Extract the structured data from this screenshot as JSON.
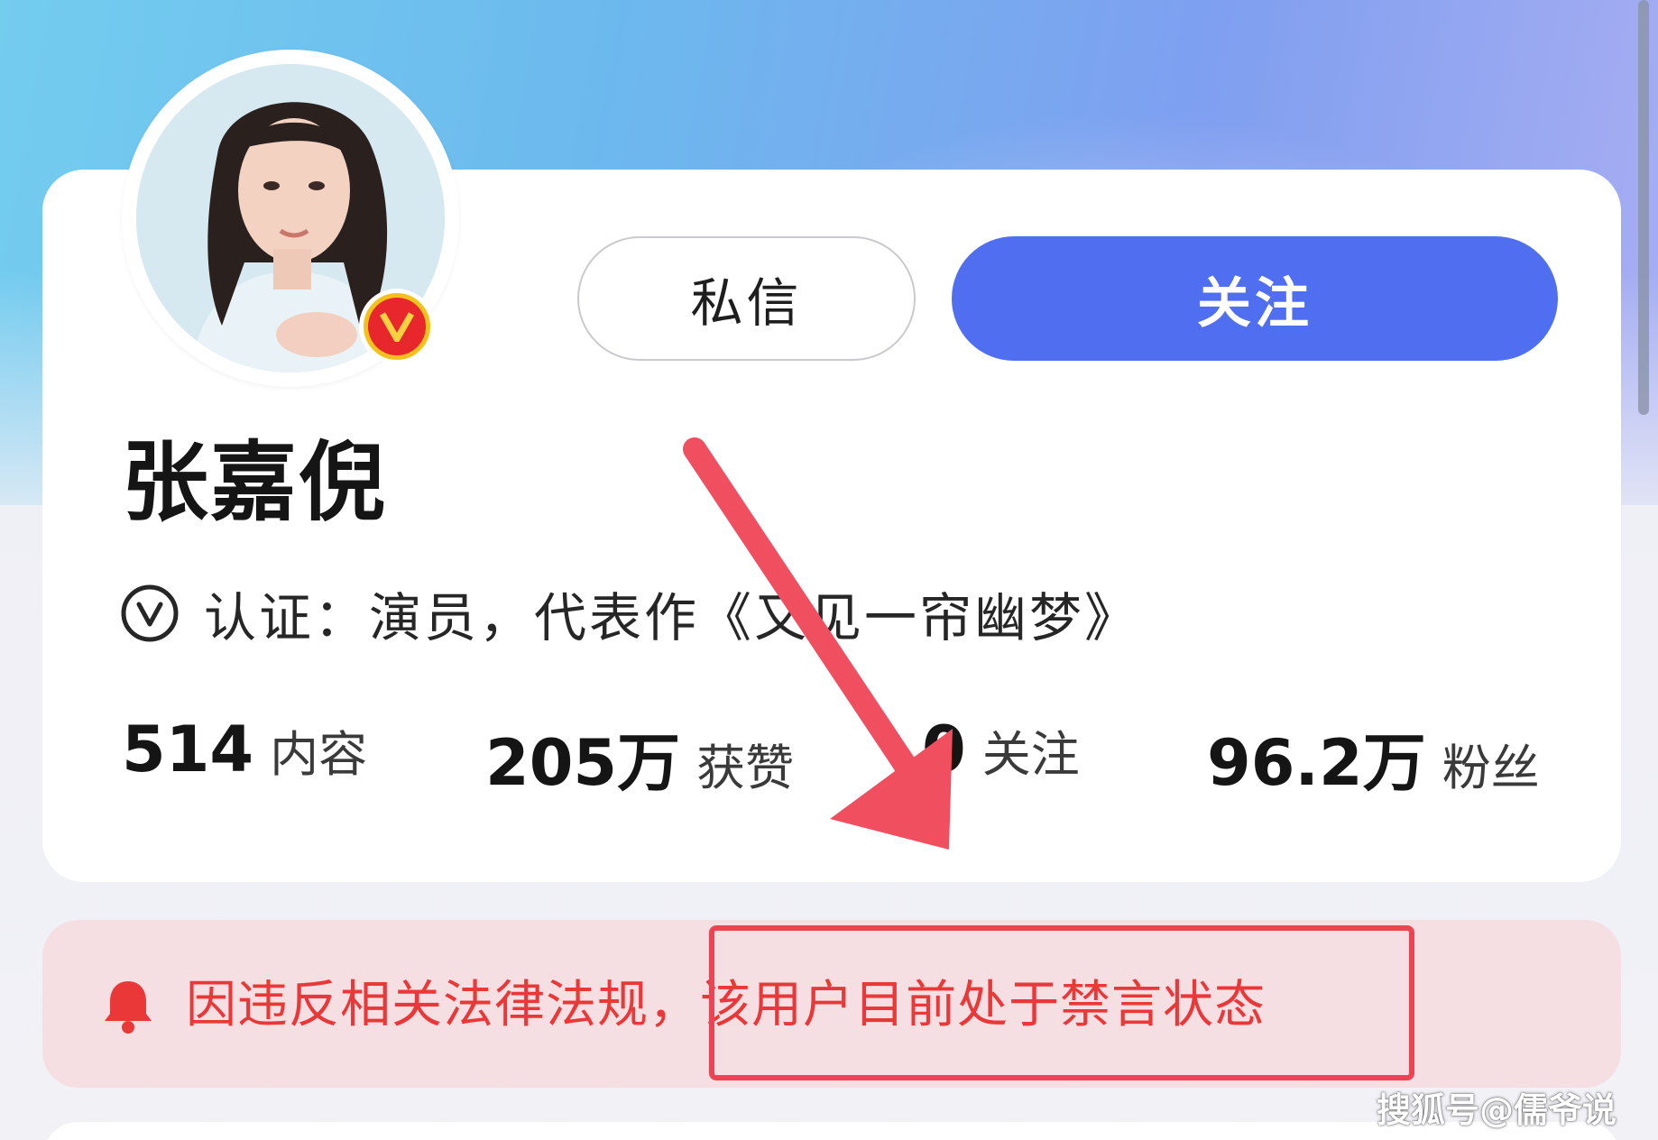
{
  "profile": {
    "name": "张嘉倪",
    "verification": "认证：演员，代表作《又见一帘幽梦》",
    "avatar_badge": "V"
  },
  "actions": {
    "message_label": "私信",
    "follow_label": "关注"
  },
  "stats": [
    {
      "value": "514",
      "label": "内容"
    },
    {
      "value": "205万",
      "label": "获赞"
    },
    {
      "value": "0",
      "label": "关注"
    },
    {
      "value": "96.2万",
      "label": "粉丝"
    }
  ],
  "notice": {
    "text": "因违反相关法律法规，该用户目前处于禁言状态"
  },
  "watermark": "搜狐号@儒爷说",
  "colors": {
    "follow_button": "#4f6ef0",
    "notice_text": "#ea3838",
    "notice_background": "#f6dfe3",
    "annotation": "#ec4452"
  },
  "icons": {
    "verify": "verified-v-icon",
    "notice": "bell-icon"
  }
}
